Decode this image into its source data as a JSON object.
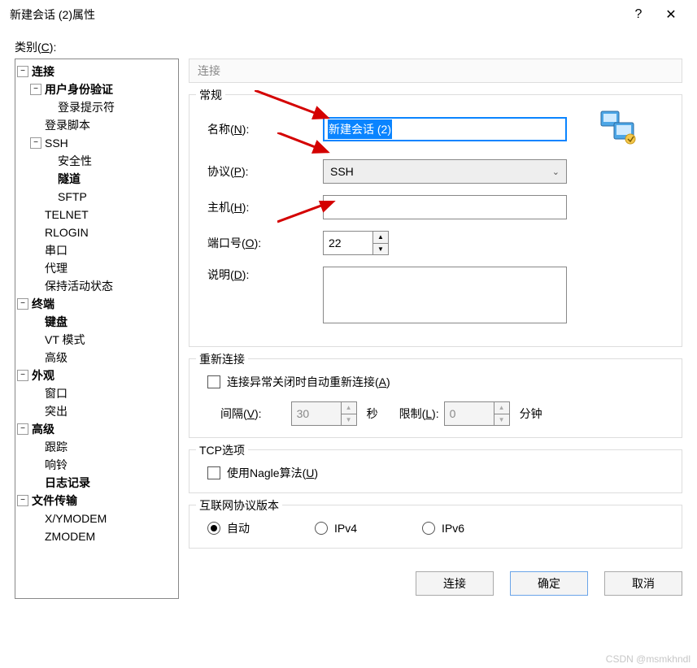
{
  "window": {
    "title": "新建会话 (2)属性",
    "help_btn": "?",
    "close_btn": "✕"
  },
  "sidebar": {
    "label_prefix": "类别(",
    "label_hotkey": "C",
    "label_suffix": "):",
    "tree": {
      "connection": "连接",
      "user_auth": "用户身份验证",
      "login_prompt": "登录提示符",
      "login_script": "登录脚本",
      "ssh": "SSH",
      "security": "安全性",
      "tunnel": "隧道",
      "sftp": "SFTP",
      "telnet": "TELNET",
      "rlogin": "RLOGIN",
      "serial": "串口",
      "proxy": "代理",
      "keepalive": "保持活动状态",
      "terminal": "终端",
      "keyboard": "键盘",
      "vt_mode": "VT 模式",
      "advanced1": "高级",
      "appearance": "外观",
      "window": "窗口",
      "highlight": "突出",
      "advanced2": "高级",
      "trace": "跟踪",
      "bell": "响铃",
      "logging": "日志记录",
      "file_transfer": "文件传输",
      "xymodem": "X/YMODEM",
      "zmodem": "ZMODEM"
    }
  },
  "panel": {
    "header": "连接",
    "group_general": "常规",
    "name_label_pre": "名称(",
    "name_hot": "N",
    "name_label_suf": "):",
    "name_value": "新建会话 (2)",
    "protocol_label_pre": "协议(",
    "protocol_hot": "P",
    "protocol_label_suf": "):",
    "protocol_value": "SSH",
    "host_label_pre": "主机(",
    "host_hot": "H",
    "host_label_suf": "):",
    "host_value": "",
    "port_label_pre": "端口号(",
    "port_hot": "O",
    "port_label_suf": "):",
    "port_value": "22",
    "desc_label_pre": "说明(",
    "desc_hot": "D",
    "desc_label_suf": "):",
    "desc_value": "",
    "group_reconnect": "重新连接",
    "auto_reconnect_pre": "连接异常关闭时自动重新连接(",
    "auto_reconnect_hot": "A",
    "auto_reconnect_suf": ")",
    "interval_label_pre": "间隔(",
    "interval_hot": "V",
    "interval_label_suf": "):",
    "interval_value": "30",
    "interval_unit": "秒",
    "limit_label_pre": "限制(",
    "limit_hot": "L",
    "limit_label_suf": "):",
    "limit_value": "0",
    "limit_unit": "分钟",
    "group_tcp": "TCP选项",
    "nagle_pre": "使用Nagle算法(",
    "nagle_hot": "U",
    "nagle_suf": ")",
    "group_ipver": "互联网协议版本",
    "ip_auto": "自动",
    "ip_v4": "IPv4",
    "ip_v6": "IPv6"
  },
  "buttons": {
    "connect": "连接",
    "ok": "确定",
    "cancel": "取消"
  },
  "watermark": "CSDN @msmkhndl"
}
